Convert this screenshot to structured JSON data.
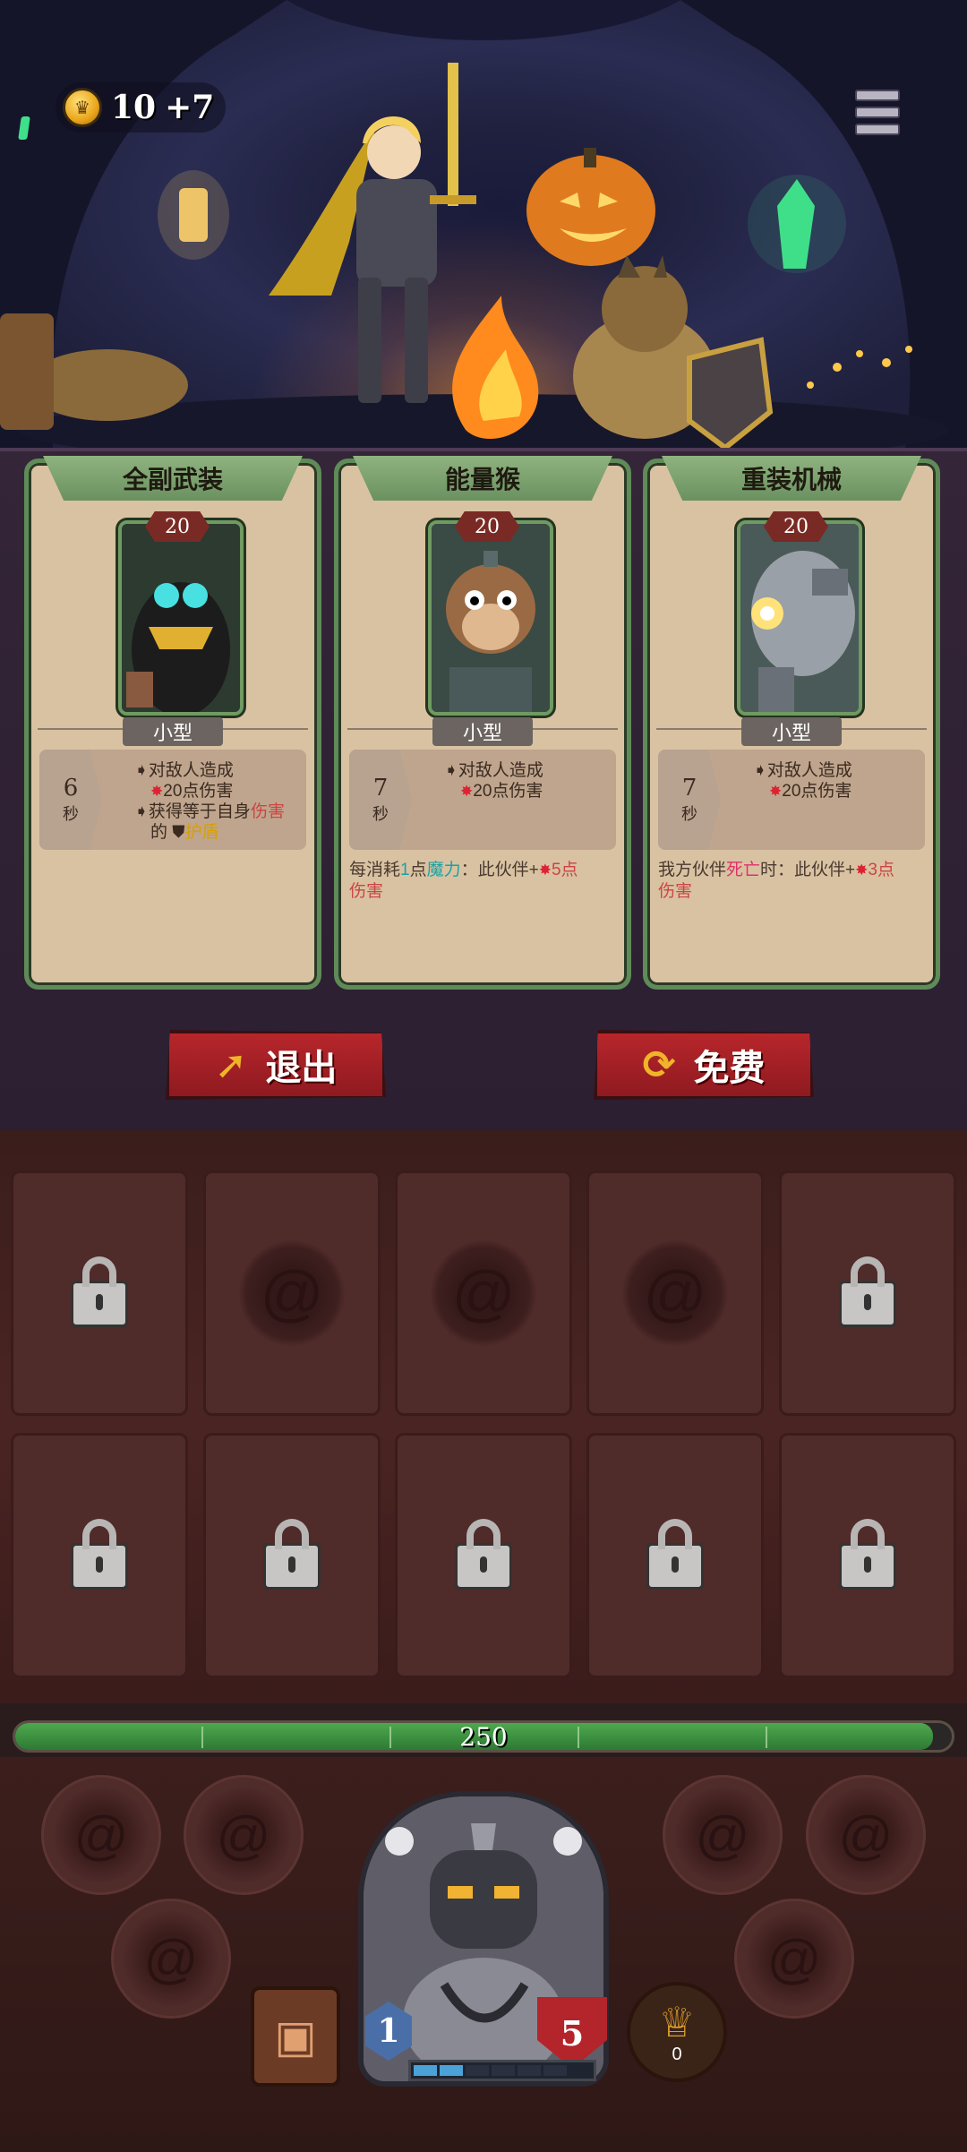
{
  "header": {
    "coins": "10",
    "coins_bonus": "+7"
  },
  "cards": [
    {
      "title": "全副武装",
      "level": "20",
      "size": "小型",
      "timer": "6",
      "timer_unit": "秒",
      "effect_lines": [
        {
          "pre": "对敌人造成"
        },
        {
          "value": "20点伤害"
        },
        {
          "pre": "获得等于自身",
          "red": "伤害"
        },
        {
          "pre": "的",
          "gold": "护盾"
        }
      ],
      "extra": null
    },
    {
      "title": "能量猴",
      "level": "20",
      "size": "小型",
      "timer": "7",
      "timer_unit": "秒",
      "effect_lines": [
        {
          "pre": "对敌人造成"
        },
        {
          "value": "20点伤害"
        }
      ],
      "extra": {
        "p1": "每消耗",
        "k1": "1",
        "p2": "点",
        "k2": "魔力",
        "p3": "：此伙伴+",
        "v": "5点",
        "p4": "伤害"
      }
    },
    {
      "title": "重装机械",
      "level": "20",
      "size": "小型",
      "timer": "7",
      "timer_unit": "秒",
      "effect_lines": [
        {
          "pre": "对敌人造成"
        },
        {
          "value": "20点伤害"
        }
      ],
      "extra": {
        "p1": "我方伙伴",
        "k1": "死亡",
        "p2": "时：此伙伴+",
        "v": "3点",
        "p3": "伤害"
      }
    }
  ],
  "buttons": {
    "exit": "退出",
    "free": "免费"
  },
  "hp": {
    "value": "250",
    "fraction": 0.98
  },
  "hero": {
    "level": "1",
    "shield": "5",
    "xp_segments_filled": 2
  },
  "trophy": {
    "count": "0"
  },
  "colors": {
    "accent": "#b7262b",
    "hp": "#3a8f3e",
    "card_border": "#5e8b57"
  }
}
